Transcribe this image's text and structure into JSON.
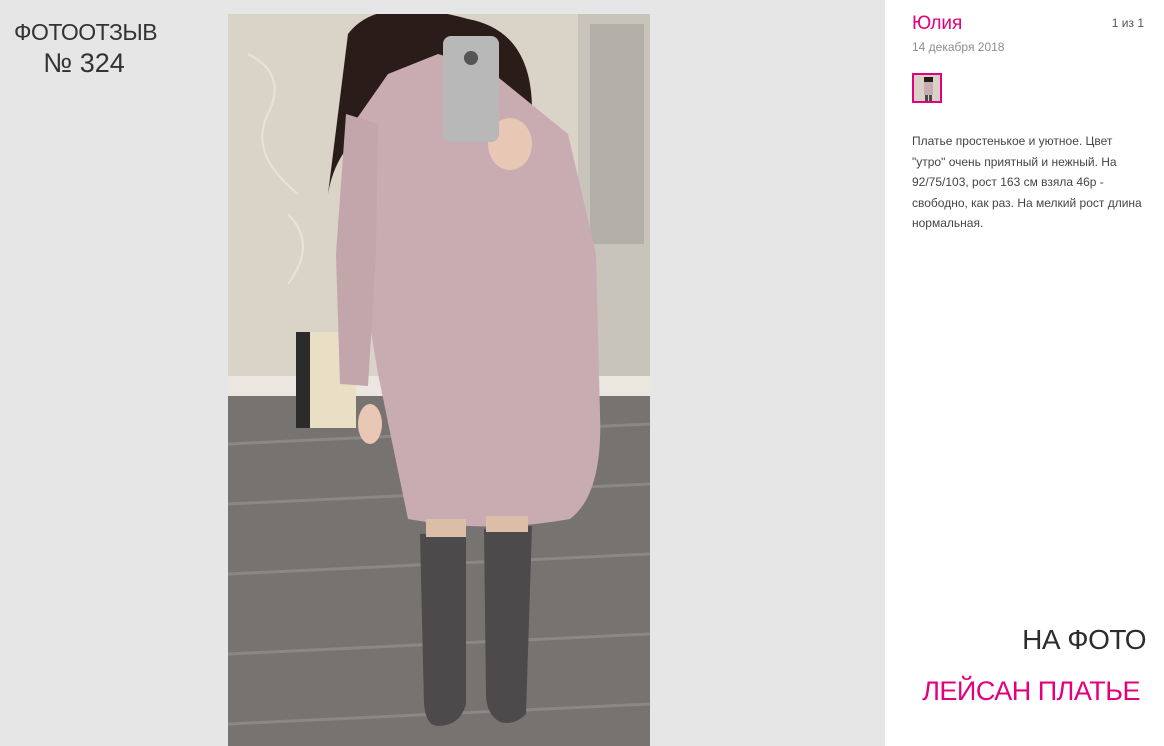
{
  "left": {
    "review_word": "ФОТООТЗЫВ",
    "review_number": "№ 324"
  },
  "photo": {
    "subject": "mirror-selfie-pink-dress"
  },
  "review": {
    "author": "Юлия",
    "counter": "1 из 1",
    "date": "14 декабря 2018",
    "text": "Платье простенькое и уютное. Цвет \"утро\" очень приятный и нежный. На 92/75/103, рост 163 см взяла 46р - свободно, как раз. На мелкий рост длина нормальная."
  },
  "footer": {
    "on_photo": "НА ФОТО",
    "product_name": "ЛЕЙСАН ПЛАТЬЕ"
  },
  "colors": {
    "accent": "#e3007d",
    "background": "#e6e6e6",
    "panel": "#ffffff"
  }
}
